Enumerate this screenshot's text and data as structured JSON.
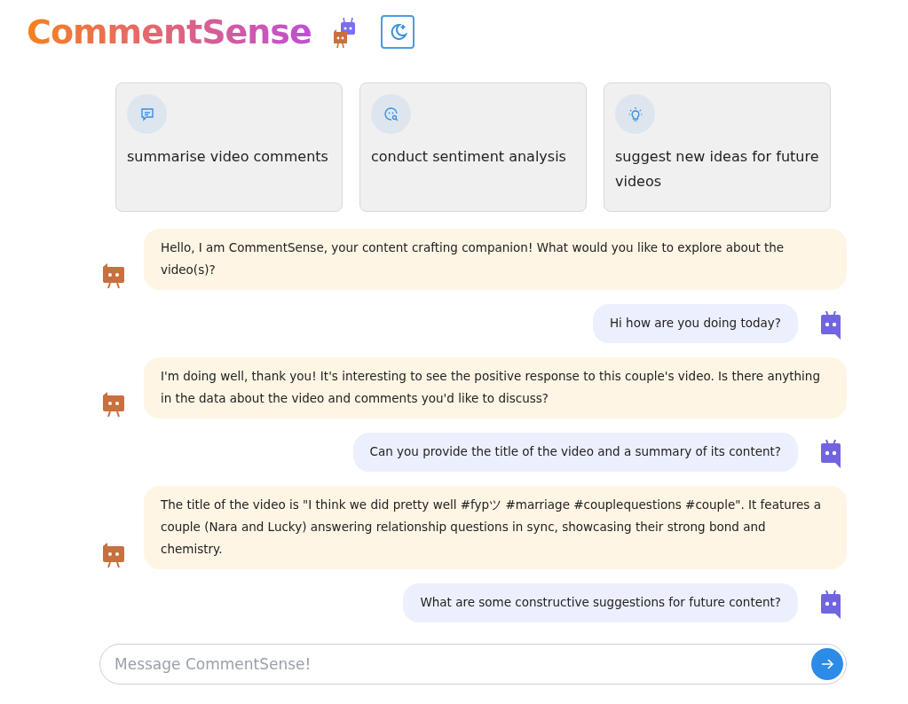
{
  "header": {
    "title": "CommentSense"
  },
  "suggestions": [
    {
      "kind": "chat",
      "label": "summarise video comments"
    },
    {
      "kind": "sentiment",
      "label": "conduct sentiment analysis"
    },
    {
      "kind": "idea",
      "label": "suggest new ideas for future videos"
    }
  ],
  "messages": [
    {
      "kind": "bot",
      "text": "Hello, I am CommentSense, your content crafting companion! What would you like to explore about the video(s)?"
    },
    {
      "kind": "user",
      "text": "Hi how are you doing today?"
    },
    {
      "kind": "bot",
      "text": "I'm doing well, thank you! It's interesting to see the positive response to this couple's video. Is there anything in the data about the video and comments you'd like to discuss?"
    },
    {
      "kind": "user",
      "text": "Can you provide the title of the video and a summary of its content?"
    },
    {
      "kind": "bot",
      "text": "The title of the video is \"I think we did pretty well #fypツ #marriage #couplequestions #couple\". It features a couple (Nara and Lucky) answering relationship questions in sync, showcasing their strong bond and chemistry."
    },
    {
      "kind": "user",
      "text": "What are some constructive suggestions for future content?"
    }
  ],
  "composer": {
    "placeholder": "Message CommentSense!"
  }
}
